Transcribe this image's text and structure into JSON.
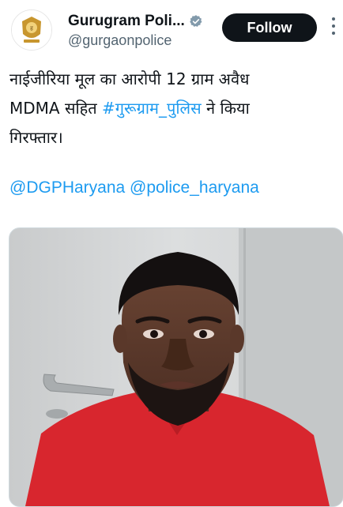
{
  "account": {
    "display_name": "Gurugram Poli...",
    "handle": "@gurgaonpolice",
    "verified": true,
    "follow_label": "Follow"
  },
  "tweet": {
    "line1": "नाईजीरिया मूल का आरोपी 12 ग्राम अवैध",
    "line2_prefix": "MDMA सहित ",
    "hashtag": "#गुरूग्राम_पुलिस",
    "line2_suffix": " ने किया",
    "line3": "गिरफ्तार।",
    "mention1": "@DGPHaryana",
    "mention2": "@police_haryana"
  },
  "colors": {
    "link": "#1d9bf0",
    "follow_bg": "#0f1419",
    "verified_badge": "#829aab",
    "shirt": "#d8262e"
  },
  "icons": {
    "avatar": "police-emblem-icon",
    "verified": "verified-badge-icon",
    "more": "more-options-icon"
  }
}
